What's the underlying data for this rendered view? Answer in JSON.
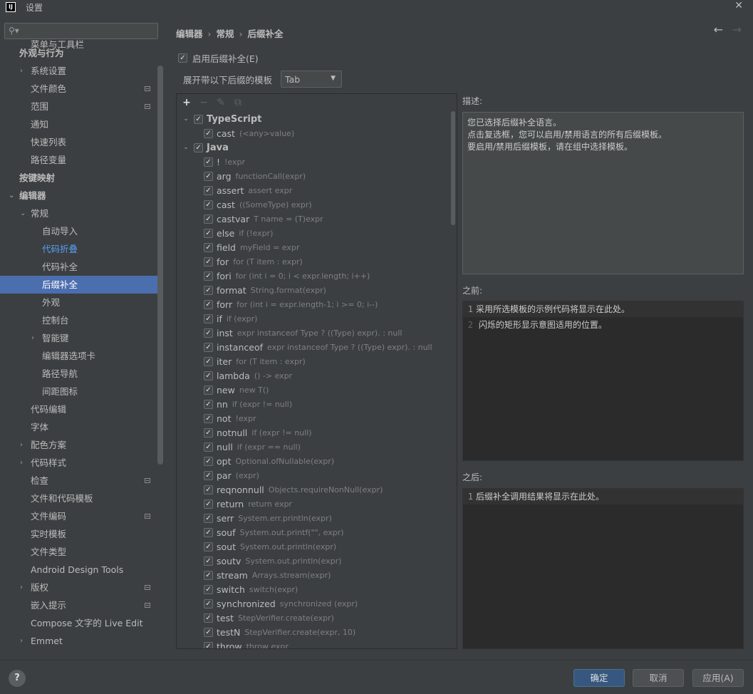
{
  "window": {
    "title": "设置",
    "logo": "IJ"
  },
  "search": {
    "placeholder": ""
  },
  "sidebar": {
    "items": [
      {
        "label": "菜单与工具栏",
        "indent": 2,
        "bold": false
      },
      {
        "label": "外观与行为",
        "indent": 1,
        "bold": true
      },
      {
        "label": "系统设置",
        "indent": 2,
        "arrow": "›"
      },
      {
        "label": "文件颜色",
        "indent": 2,
        "mini": true
      },
      {
        "label": "范围",
        "indent": 2,
        "mini": true
      },
      {
        "label": "通知",
        "indent": 2
      },
      {
        "label": "快速列表",
        "indent": 2
      },
      {
        "label": "路径变量",
        "indent": 2
      },
      {
        "label": "按键映射",
        "indent": 1,
        "bold": true
      },
      {
        "label": "编辑器",
        "indent": 1,
        "bold": true,
        "arrow": "⌄"
      },
      {
        "label": "常规",
        "indent": 2,
        "arrow": "⌄"
      },
      {
        "label": "自动导入",
        "indent": 3
      },
      {
        "label": "代码折叠",
        "indent": 3,
        "link": true
      },
      {
        "label": "代码补全",
        "indent": 3
      },
      {
        "label": "后缀补全",
        "indent": 3,
        "selected": true
      },
      {
        "label": "外观",
        "indent": 3
      },
      {
        "label": "控制台",
        "indent": 3
      },
      {
        "label": "智能键",
        "indent": 3,
        "arrow": "›"
      },
      {
        "label": "编辑器选项卡",
        "indent": 3
      },
      {
        "label": "路径导航",
        "indent": 3
      },
      {
        "label": "间距图标",
        "indent": 3
      },
      {
        "label": "代码编辑",
        "indent": 2
      },
      {
        "label": "字体",
        "indent": 2
      },
      {
        "label": "配色方案",
        "indent": 2,
        "arrow": "›"
      },
      {
        "label": "代码样式",
        "indent": 2,
        "arrow": "›"
      },
      {
        "label": "检查",
        "indent": 2,
        "mini": true
      },
      {
        "label": "文件和代码模板",
        "indent": 2
      },
      {
        "label": "文件编码",
        "indent": 2,
        "mini": true
      },
      {
        "label": "实时模板",
        "indent": 2
      },
      {
        "label": "文件类型",
        "indent": 2
      },
      {
        "label": "Android Design Tools",
        "indent": 2
      },
      {
        "label": "版权",
        "indent": 2,
        "arrow": "›",
        "mini": true
      },
      {
        "label": "嵌入提示",
        "indent": 2,
        "mini": true
      },
      {
        "label": "Compose 文字的 Live Edit",
        "indent": 2
      },
      {
        "label": "Emmet",
        "indent": 2,
        "arrow": "›"
      }
    ]
  },
  "breadcrumb": {
    "items": [
      "编辑器",
      "常规",
      "后缀补全"
    ],
    "separator": "›"
  },
  "nav": {
    "back": "←",
    "forward": "→"
  },
  "enable": {
    "label": "启用后缀补全(E)",
    "checked": true
  },
  "expand": {
    "label": "展开带以下后缀的模板",
    "value": "Tab"
  },
  "toolbar": {
    "add": "+",
    "remove": "−",
    "edit": "✎",
    "copy": "⧉"
  },
  "templates": [
    {
      "key": "TypeScript",
      "group": true
    },
    {
      "key": "cast",
      "ex": "(<any>value)"
    },
    {
      "key": "Java",
      "group": true
    },
    {
      "key": "!",
      "ex": "!expr"
    },
    {
      "key": "arg",
      "ex": "functionCall(expr)"
    },
    {
      "key": "assert",
      "ex": "assert expr"
    },
    {
      "key": "cast",
      "ex": "((SomeType) expr)"
    },
    {
      "key": "castvar",
      "ex": "T name = (T)expr"
    },
    {
      "key": "else",
      "ex": "if (!expr)"
    },
    {
      "key": "field",
      "ex": "myField = expr"
    },
    {
      "key": "for",
      "ex": "for (T item : expr)"
    },
    {
      "key": "fori",
      "ex": "for (int i = 0; i < expr.length; i++)"
    },
    {
      "key": "format",
      "ex": "String.format(expr)"
    },
    {
      "key": "forr",
      "ex": "for (int i = expr.length-1; i >= 0; i--)"
    },
    {
      "key": "if",
      "ex": "if (expr)"
    },
    {
      "key": "inst",
      "ex": "expr instanceof Type ? ((Type) expr). : null"
    },
    {
      "key": "instanceof",
      "ex": "expr instanceof Type ? ((Type) expr). : null"
    },
    {
      "key": "iter",
      "ex": "for (T item : expr)"
    },
    {
      "key": "lambda",
      "ex": "() -> expr"
    },
    {
      "key": "new",
      "ex": "new T()"
    },
    {
      "key": "nn",
      "ex": "if (expr != null)"
    },
    {
      "key": "not",
      "ex": "!expr"
    },
    {
      "key": "notnull",
      "ex": "if (expr != null)"
    },
    {
      "key": "null",
      "ex": "if (expr == null)"
    },
    {
      "key": "opt",
      "ex": "Optional.ofNullable(expr)"
    },
    {
      "key": "par",
      "ex": "(expr)"
    },
    {
      "key": "reqnonnull",
      "ex": "Objects.requireNonNull(expr)"
    },
    {
      "key": "return",
      "ex": "return expr"
    },
    {
      "key": "serr",
      "ex": "System.err.println(expr)"
    },
    {
      "key": "souf",
      "ex": "System.out.printf(\"\", expr)"
    },
    {
      "key": "sout",
      "ex": "System.out.println(expr)"
    },
    {
      "key": "soutv",
      "ex": "System.out.println(expr)"
    },
    {
      "key": "stream",
      "ex": "Arrays.stream(expr)"
    },
    {
      "key": "switch",
      "ex": "switch(expr)"
    },
    {
      "key": "synchronized",
      "ex": "synchronized (expr)"
    },
    {
      "key": "test",
      "ex": "StepVerifier.create(expr)"
    },
    {
      "key": "testN",
      "ex": "StepVerifier.create(expr, 10)"
    },
    {
      "key": "throw",
      "ex": "throw expr"
    }
  ],
  "description": {
    "label": "描述:",
    "lines": [
      "您已选择后缀补全语言。",
      "点击复选框，您可以启用/禁用语言的所有后缀模板。",
      "要启用/禁用后缀模板，请在组中选择模板。"
    ]
  },
  "before": {
    "label": "之前:",
    "lines": [
      {
        "n": "1",
        "text": "采用所选模板的示例代码将显示在此处。"
      },
      {
        "n": "2",
        "text": "  闪烁的矩形显示意图适用的位置。"
      }
    ]
  },
  "after": {
    "label": "之后:",
    "lines": [
      {
        "n": "1",
        "text": "后缀补全调用结果将显示在此处。"
      }
    ]
  },
  "buttons": {
    "help": "?",
    "ok": "确定",
    "cancel": "取消",
    "apply": "应用(A)"
  }
}
